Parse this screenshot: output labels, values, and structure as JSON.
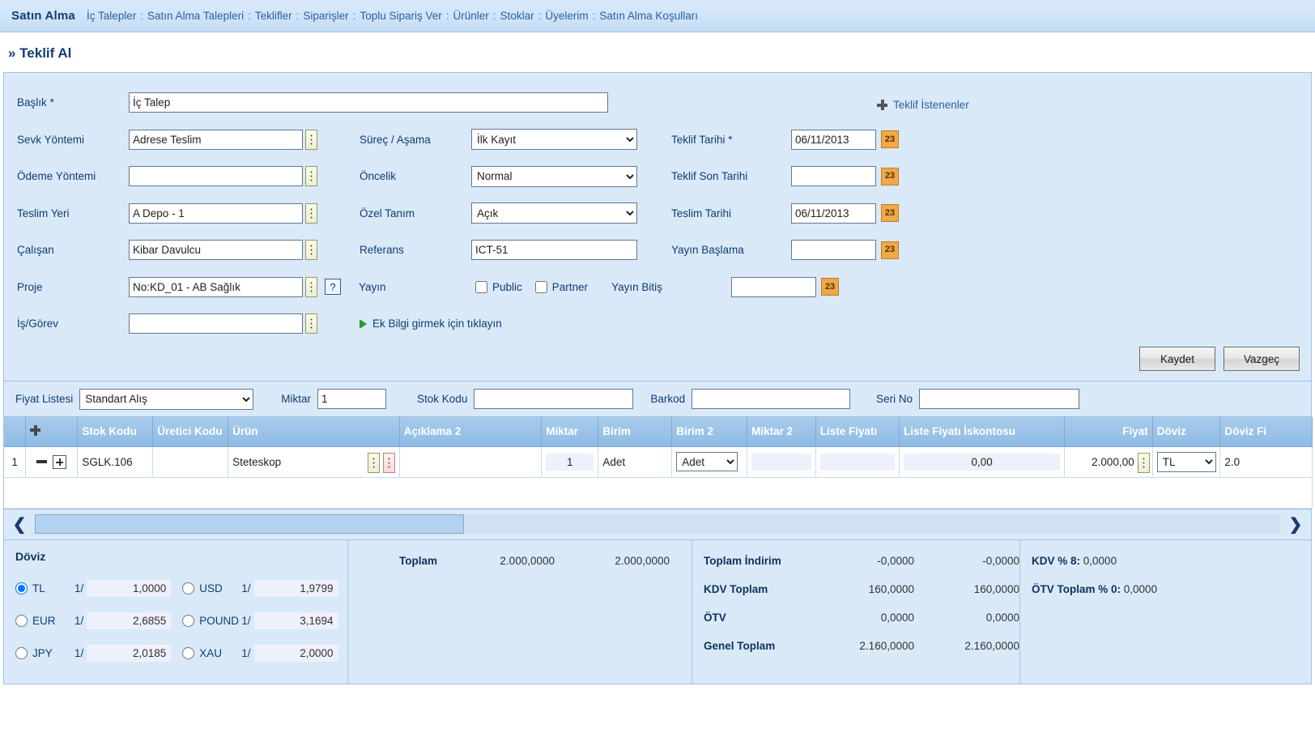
{
  "topnav": {
    "brand": "Satın Alma",
    "separator": ":",
    "links": [
      "İç Talepler",
      "Satın Alma Talepleri",
      "Teklifler",
      "Siparişler",
      "Toplu Sipariş Ver",
      "Ürünler",
      "Stoklar",
      "Üyelerim",
      "Satın Alma Koşulları"
    ]
  },
  "page": {
    "title": "» Teklif Al"
  },
  "form": {
    "baslik": {
      "label": "Başlık *",
      "value": "İç Talep"
    },
    "sevk_yontemi": {
      "label": "Sevk Yöntemi",
      "value": "Adrese Teslim"
    },
    "odeme_yontemi": {
      "label": "Ödeme Yöntemi",
      "value": ""
    },
    "teslim_yeri": {
      "label": "Teslim Yeri",
      "value": "A Depo - 1"
    },
    "calisan": {
      "label": "Çalışan",
      "value": "Kibar Davulcu"
    },
    "proje": {
      "label": "Proje",
      "value": "No:KD_01 - AB Sağlık",
      "help": "?"
    },
    "is_gorev": {
      "label": "İş/Görev",
      "value": ""
    },
    "surec_asama": {
      "label": "Süreç / Aşama",
      "value": "İlk Kayıt"
    },
    "oncelik": {
      "label": "Öncelik",
      "value": "Normal"
    },
    "ozel_tanim": {
      "label": "Özel Tanım",
      "value": "Açık"
    },
    "referans": {
      "label": "Referans",
      "value": "ICT-51"
    },
    "yayin": {
      "label": "Yayın",
      "public": "Public",
      "partner": "Partner"
    },
    "teklif_tarihi": {
      "label": "Teklif Tarihi *",
      "value": "06/11/2013"
    },
    "teklif_son_tarihi": {
      "label": "Teklif Son Tarihi",
      "value": ""
    },
    "teslim_tarihi": {
      "label": "Teslim Tarihi",
      "value": "06/11/2013"
    },
    "yayin_baslama": {
      "label": "Yayın Başlama",
      "value": ""
    },
    "yayin_bitis": {
      "label": "Yayın Bitiş",
      "value": ""
    },
    "calendar_icon_label": "23",
    "teklif_istenenler": "Teklif İstenenler",
    "ek_bilgi": "Ek Bilgi girmek için tıklayın",
    "kaydet": "Kaydet",
    "vazgec": "Vazgeç"
  },
  "filterbar": {
    "fiyat_listesi": {
      "label": "Fiyat Listesi",
      "value": "Standart Alış"
    },
    "miktar": {
      "label": "Miktar",
      "value": "1"
    },
    "stok_kodu": {
      "label": "Stok Kodu",
      "value": ""
    },
    "barkod": {
      "label": "Barkod",
      "value": ""
    },
    "seri_no": {
      "label": "Seri No",
      "value": ""
    }
  },
  "grid": {
    "headers": {
      "rownum": "",
      "plus": "",
      "stok_kodu": "Stok Kodu",
      "uretici_kodu": "Üretici Kodu",
      "urun": "Ürün",
      "aciklama2": "Açıklama 2",
      "miktar": "Miktar",
      "birim": "Birim",
      "birim2": "Birim 2",
      "miktar2": "Miktar 2",
      "liste_fiyati": "Liste Fiyatı",
      "liste_fiyati_iskontosu": "Liste Fiyatı İskontosu",
      "fiyat": "Fiyat",
      "doviz": "Döviz",
      "doviz_fi": "Döviz Fi"
    },
    "rows": [
      {
        "rownum": "1",
        "stok_kodu": "SGLK.106",
        "uretici_kodu": "",
        "urun": "Steteskop",
        "aciklama2": "",
        "miktar": "1",
        "birim": "Adet",
        "birim2": "Adet",
        "miktar2": "",
        "liste_fiyati": "",
        "liste_fiyati_iskontosu": "0,00",
        "fiyat": "2.000,00",
        "doviz": "TL",
        "doviz_fi": "2.0"
      }
    ]
  },
  "doviz": {
    "title": "Döviz",
    "slash": "1/",
    "rates": [
      {
        "name": "TL",
        "ratio": "1/",
        "value": "1,0000",
        "selected": true
      },
      {
        "name": "USD",
        "ratio": "1/",
        "value": "1,9799",
        "selected": false
      },
      {
        "name": "EUR",
        "ratio": "1/",
        "value": "2,6855",
        "selected": false
      },
      {
        "name": "POUND",
        "ratio": "1/",
        "value": "3,1694",
        "selected": false
      },
      {
        "name": "JPY",
        "ratio": "1/",
        "value": "2,0185",
        "selected": false
      },
      {
        "name": "XAU",
        "ratio": "1/",
        "value": "2,0000",
        "selected": false
      }
    ]
  },
  "totals": {
    "toplam": {
      "label": "Toplam",
      "v1": "2.000,0000",
      "v2": "2.000,0000"
    },
    "rows": [
      {
        "label": "Toplam İndirim",
        "v1": "-0,0000",
        "v2": "-0,0000"
      },
      {
        "label": "KDV Toplam",
        "v1": "160,0000",
        "v2": "160,0000"
      },
      {
        "label": "ÖTV",
        "v1": "0,0000",
        "v2": "0,0000"
      },
      {
        "label": "Genel Toplam",
        "v1": "2.160,0000",
        "v2": "2.160,0000"
      }
    ],
    "taxes": [
      {
        "label": "KDV % 8:",
        "value": "0,0000"
      },
      {
        "label": "ÖTV Toplam % 0:",
        "value": "0,0000"
      }
    ]
  },
  "scroll": {
    "left_arrow": "❮",
    "right_arrow": "❯"
  },
  "colors": {
    "nav_bg": "#cfe4f8",
    "panel_bg": "#d9e9f8",
    "header_blue": "#8fbbe4",
    "accent": "#123c72",
    "calendar": "#f0a848"
  }
}
